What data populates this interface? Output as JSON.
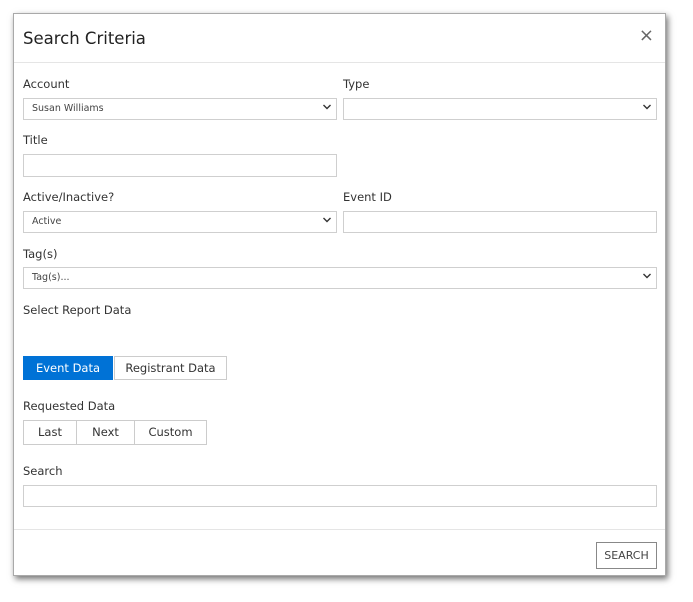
{
  "dialog": {
    "title": "Search Criteria",
    "close_glyph": "×"
  },
  "form": {
    "account": {
      "label": "Account",
      "value": "Susan Williams"
    },
    "type": {
      "label": "Type",
      "value": ""
    },
    "title": {
      "label": "Title",
      "value": ""
    },
    "active": {
      "label": "Active/Inactive?",
      "value": "Active"
    },
    "event_id": {
      "label": "Event ID",
      "value": ""
    },
    "tags": {
      "label": "Tag(s)",
      "value": "Tag(s)..."
    },
    "report_data": {
      "label": "Select Report Data",
      "options": [
        "Event Data",
        "Registrant Data"
      ],
      "selected": "Event Data"
    },
    "requested_data": {
      "label": "Requested Data",
      "options": [
        "Last",
        "Next",
        "Custom"
      ]
    },
    "search": {
      "label": "Search",
      "value": ""
    }
  },
  "footer": {
    "search_button": "SEARCH"
  },
  "colors": {
    "accent": "#0072d6"
  },
  "icons": {
    "close": "close-icon",
    "dropdown": "chevron-down-icon"
  }
}
